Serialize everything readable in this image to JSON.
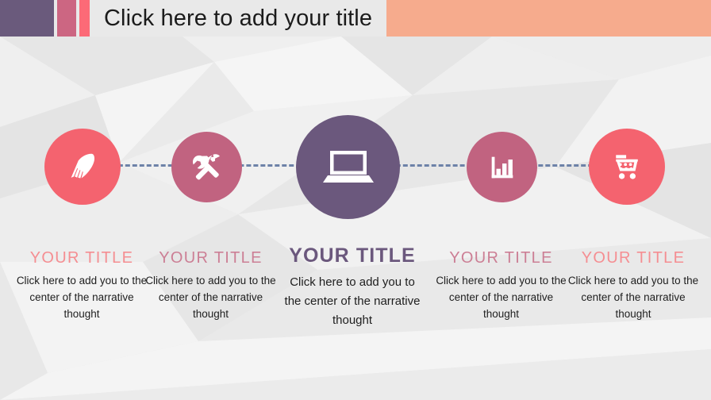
{
  "slide": {
    "header": {
      "title": "Click here to add your title",
      "accent_bars": [
        {
          "name": "purple-bar",
          "color": "#6a5a7c"
        },
        {
          "name": "rose-bar",
          "color": "#cc6682"
        },
        {
          "name": "coral-bar",
          "color": "#fc6a77"
        },
        {
          "name": "peach-bar",
          "color": "#f6ab8d"
        }
      ],
      "title_color": "#1b1b1b"
    },
    "connector": {
      "style": "dashed",
      "color": "#6d82a8"
    },
    "nodes": [
      {
        "icon": "pen-nib-icon",
        "color": "#f4636f"
      },
      {
        "icon": "hammer-wrench-icon",
        "color": "#c16380"
      },
      {
        "icon": "laptop-icon",
        "color": "#6b587d"
      },
      {
        "icon": "bar-chart-icon",
        "color": "#c16380"
      },
      {
        "icon": "shopping-cart-icon",
        "color": "#f4636f"
      }
    ],
    "columns": [
      {
        "title": "YOUR  TITLE",
        "title_color": "#f58e92",
        "body": "Click here to add you to the  center of the narrative thought"
      },
      {
        "title": "YOUR  TITLE",
        "title_color": "#cc7f95",
        "body": "Click here to add you to the  center of the narrative thought"
      },
      {
        "title": "YOUR  TITLE",
        "title_color": "#6b587d",
        "body": "Click here to add you to the  center of the narrative thought"
      },
      {
        "title": "YOUR  TITLE",
        "title_color": "#cc7f95",
        "body": "Click here to add you to the  center of the narrative thought"
      },
      {
        "title": "YOUR  TITLE",
        "title_color": "#f58e92",
        "body": "Click here to add you to the  center of the narrative thought"
      }
    ]
  }
}
